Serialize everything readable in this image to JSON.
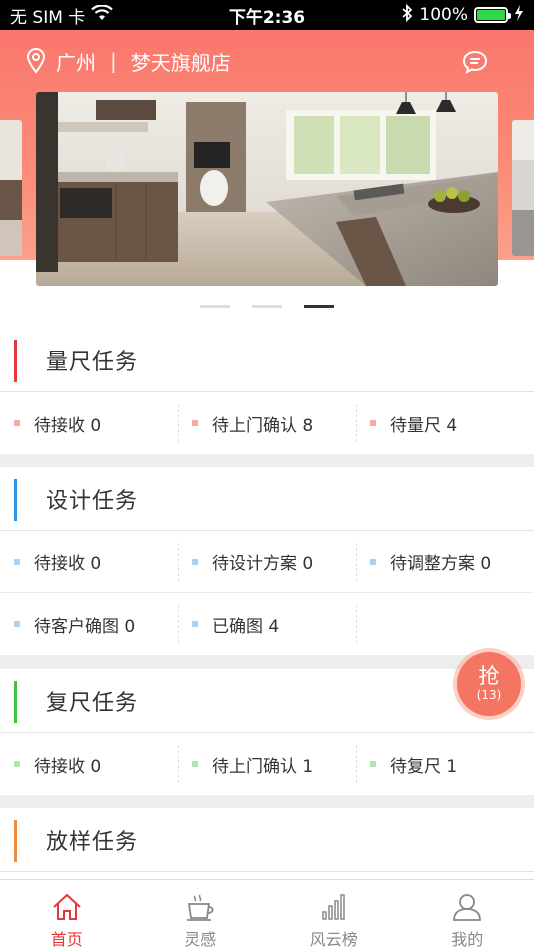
{
  "status_bar": {
    "carrier": "无 SIM 卡",
    "time": "下午2:36",
    "battery": "100%",
    "battery_level": 1.0
  },
  "header": {
    "city": "广州",
    "separator": "|",
    "store": "梦天旗舰店",
    "location_icon": "location-pin-icon",
    "message_icon": "message-icon"
  },
  "banner": {
    "image_subject": "modern kitchen interior",
    "dot_count": 3,
    "active_dot": 2
  },
  "sections": [
    {
      "title": "量尺任务",
      "accent": "#e5393c",
      "bullet": "#f7a9a3",
      "items": [
        {
          "label": "待接收 0"
        },
        {
          "label": "待上门确认 8"
        },
        {
          "label": "待量尺 4"
        }
      ]
    },
    {
      "title": "设计任务",
      "accent": "#2b95e8",
      "bullet": "#a9d3f5",
      "items": [
        {
          "label": "待接收 0"
        },
        {
          "label": "待设计方案 0"
        },
        {
          "label": "待调整方案 0"
        },
        {
          "label": "待客户确图 0"
        },
        {
          "label": "已确图 4"
        }
      ]
    },
    {
      "title": "复尺任务",
      "accent": "#3fc43a",
      "bullet": "#aee8aa",
      "items": [
        {
          "label": "待接收 0"
        },
        {
          "label": "待上门确认 1"
        },
        {
          "label": "待复尺 1"
        }
      ]
    },
    {
      "title": "放样任务",
      "accent": "#f08a3c",
      "bullet": "#f8c7a1",
      "items": []
    }
  ],
  "grab_button": {
    "label": "抢",
    "count": "(13)"
  },
  "tab_bar": {
    "tabs": [
      {
        "label": "首页",
        "icon": "home-icon",
        "active": true
      },
      {
        "label": "灵感",
        "icon": "coffee-cup-icon",
        "active": false
      },
      {
        "label": "风云榜",
        "icon": "bar-chart-icon",
        "active": false
      },
      {
        "label": "我的",
        "icon": "user-icon",
        "active": false
      }
    ]
  },
  "colors": {
    "brand_gradient_top": "#fa776d",
    "active_tab": "#e3393c",
    "grab_button": "#f47561"
  }
}
